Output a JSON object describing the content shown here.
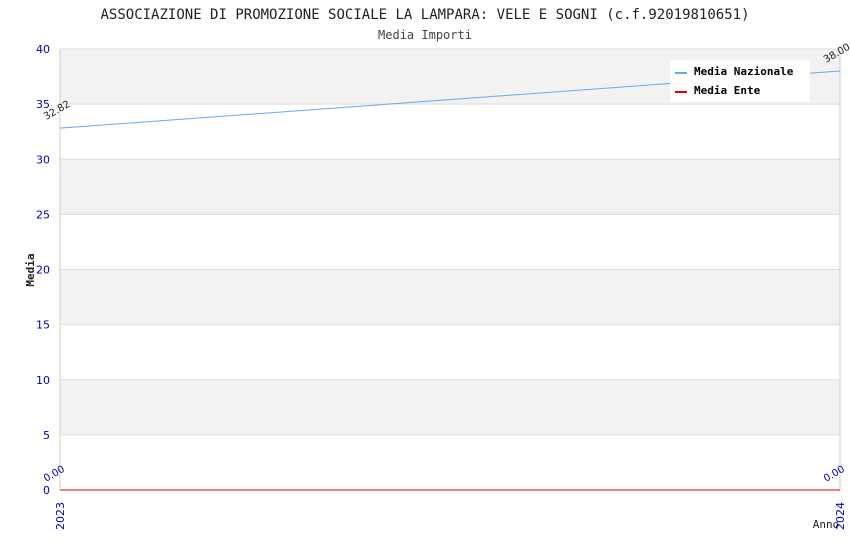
{
  "chart_data": {
    "type": "line",
    "title": "ASSOCIAZIONE DI PROMOZIONE SOCIALE LA LAMPARA: VELE E SOGNI (c.f.92019810651)",
    "subtitle": "Media Importi",
    "xlabel": "Anno",
    "ylabel": "Media",
    "categories": [
      "2023",
      "2024"
    ],
    "ylim": [
      0,
      40
    ],
    "yticks": [
      "0",
      "5",
      "10",
      "15",
      "20",
      "25",
      "30",
      "35",
      "40"
    ],
    "grid": "horizontal bands",
    "legend_position": "top-right",
    "series": [
      {
        "name": "Media Nazionale",
        "color": "#66aaee",
        "values": [
          32.82,
          38.0
        ],
        "labels": [
          "32.82",
          "38.00"
        ]
      },
      {
        "name": "Media Ente",
        "color": "#dd0000",
        "values": [
          0,
          0
        ],
        "labels": [
          "0.00",
          "0.00"
        ]
      }
    ],
    "colors": {
      "band": "#f2f2f2",
      "axis_text": "#0000aa",
      "grid": "#dddddd"
    }
  }
}
